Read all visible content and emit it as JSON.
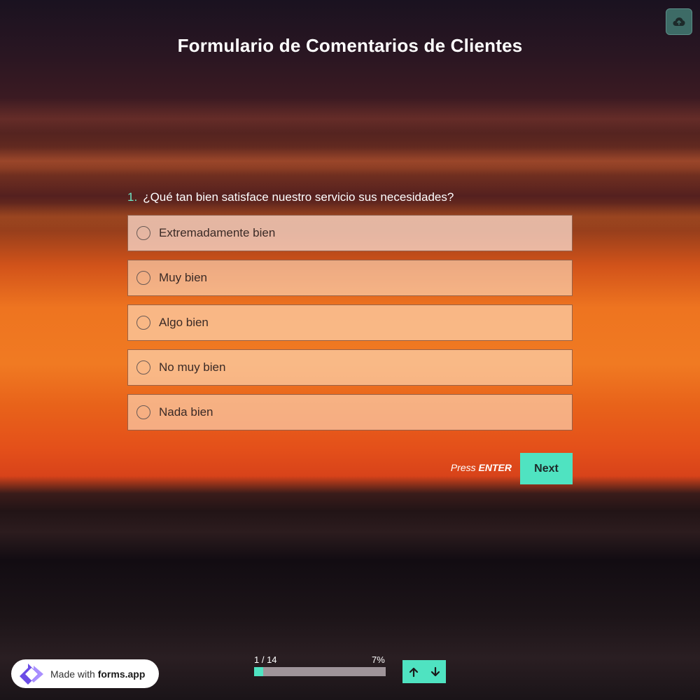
{
  "form": {
    "title": "Formulario de Comentarios de Clientes"
  },
  "question": {
    "number": "1.",
    "text": "¿Qué tan bien satisface nuestro servicio sus necesidades?",
    "options": [
      {
        "label": "Extremadamente bien"
      },
      {
        "label": "Muy bien"
      },
      {
        "label": "Algo bien"
      },
      {
        "label": "No muy bien"
      },
      {
        "label": "Nada bien"
      }
    ]
  },
  "actions": {
    "press_prefix": "Press",
    "press_key": "ENTER",
    "next_label": "Next"
  },
  "progress": {
    "counter": "1 / 14",
    "percent_label": "7%",
    "fraction": 0.07
  },
  "branding": {
    "made_with": "Made with",
    "brand": "forms.app"
  },
  "icons": {
    "upload": "cloud-upload-icon",
    "up": "arrow-up-icon",
    "down": "arrow-down-icon",
    "logo": "forms-app-logo"
  },
  "colors": {
    "accent": "#4fe3c1",
    "question_number": "#6ee6c6",
    "upload_bg": "#3d6b66"
  }
}
